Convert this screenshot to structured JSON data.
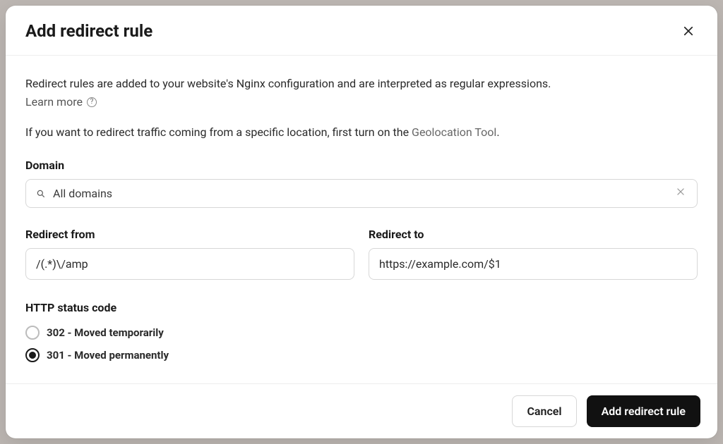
{
  "header": {
    "title": "Add redirect rule"
  },
  "body": {
    "intro": "Redirect rules are added to your website's Nginx configuration and are interpreted as regular expressions.",
    "learn_more": "Learn more",
    "geo_prefix": "If you want to redirect traffic coming from a specific location, first turn on the ",
    "geo_link": "Geolocation Tool",
    "geo_suffix": "."
  },
  "domain": {
    "label": "Domain",
    "selected": "All domains"
  },
  "redirect_from": {
    "label": "Redirect from",
    "value": "/(.*)\\/amp"
  },
  "redirect_to": {
    "label": "Redirect to",
    "value": "https://example.com/$1"
  },
  "status_code": {
    "label": "HTTP status code",
    "options": [
      {
        "label": "302 - Moved temporarily",
        "checked": false
      },
      {
        "label": "301 - Moved permanently",
        "checked": true
      }
    ]
  },
  "footer": {
    "cancel": "Cancel",
    "submit": "Add redirect rule"
  }
}
